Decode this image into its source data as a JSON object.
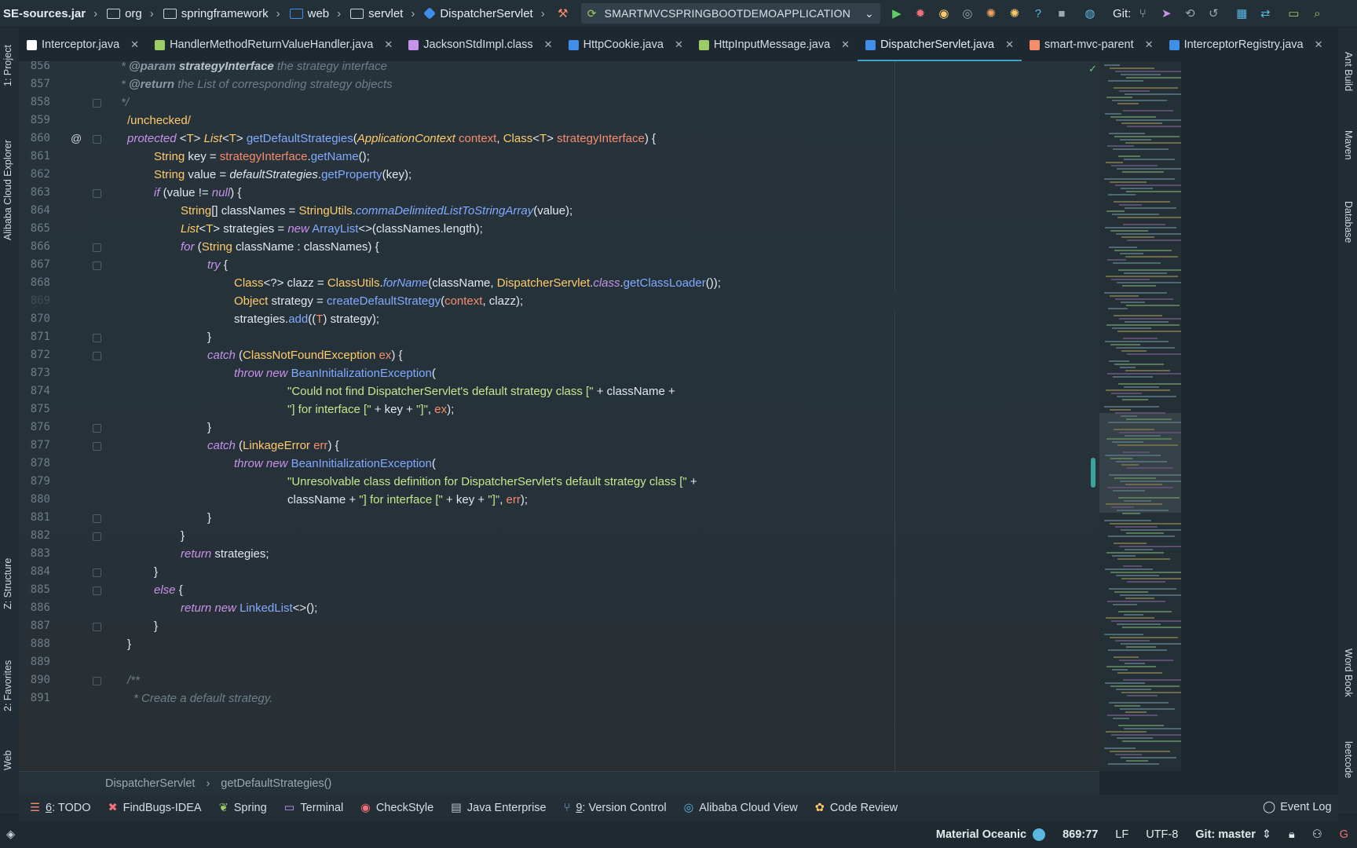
{
  "navbar": {
    "crumbs": [
      "SE-sources.jar",
      "org",
      "springframework",
      "web",
      "servlet",
      "DispatcherServlet"
    ],
    "run_config": "SMARTMVCSPRINGBOOTDEMOAPPLICATION",
    "git_label": "Git:"
  },
  "tabs": [
    {
      "label": "Interceptor.java",
      "icon_color": "#ffffff"
    },
    {
      "label": "HandlerMethodReturnValueHandler.java",
      "icon_color": "#9ccc65"
    },
    {
      "label": "JacksonStdImpl.class",
      "icon_color": "#c792ea"
    },
    {
      "label": "HttpCookie.java",
      "icon_color": "#3f8ee8"
    },
    {
      "label": "HttpInputMessage.java",
      "icon_color": "#9ccc65"
    },
    {
      "label": "DispatcherServlet.java",
      "icon_color": "#3f8ee8",
      "active": true
    },
    {
      "label": "smart-mvc-parent",
      "icon_color": "#f78c6c"
    },
    {
      "label": "InterceptorRegistry.java",
      "icon_color": "#3f8ee8"
    }
  ],
  "tabs_overflow": "3",
  "left_tools": [
    "1: Project",
    "Alibaba Cloud Explorer",
    "Z: Structure",
    "2: Favorites",
    "Web"
  ],
  "right_tools": [
    "Ant Build",
    "Maven",
    "Database",
    "Word Book",
    "leetcode"
  ],
  "editor": {
    "current_line": 869,
    "lines": [
      856,
      857,
      858,
      859,
      860,
      861,
      862,
      863,
      864,
      865,
      866,
      867,
      868,
      869,
      870,
      871,
      872,
      873,
      874,
      875,
      876,
      877,
      878,
      879,
      880,
      881,
      882,
      883,
      884,
      885,
      886,
      887,
      888,
      889,
      890,
      891
    ],
    "code": {
      "l856_tag": "@param",
      "l856_name": "strategyInterface",
      "l856_text": "the strategy interface",
      "l857_tag": "@return",
      "l857_text": "the List of corresponding strategy objects",
      "l859": "/unchecked/",
      "l874_str": "\"Could not find DispatcherServlet's default strategy class [\"",
      "l875_str": "\"] for interface [\"",
      "l875_str2": "\"]\"",
      "l879_str": "\"Unresolvable class definition for DispatcherServlet's default strategy class [\"",
      "l880_str": "\"] for interface [\"",
      "l880_str2": "\"]\"",
      "l891": "* Create a default strategy."
    }
  },
  "edcrumb": [
    "DispatcherServlet",
    "getDefaultStrategies()"
  ],
  "tool_windows": [
    {
      "num": "6",
      "label": ": TODO"
    },
    {
      "num": "",
      "label": "FindBugs-IDEA"
    },
    {
      "num": "",
      "label": "Spring"
    },
    {
      "num": "",
      "label": "Terminal"
    },
    {
      "num": "",
      "label": "CheckStyle"
    },
    {
      "num": "",
      "label": "Java Enterprise"
    },
    {
      "num": "9",
      "label": ": Version Control"
    },
    {
      "num": "",
      "label": "Alibaba Cloud View"
    },
    {
      "num": "",
      "label": "Code Review"
    }
  ],
  "event_log": "Event Log",
  "status": {
    "theme": "Material Oceanic",
    "position": "869:77",
    "line_sep": "LF",
    "encoding": "UTF-8",
    "git_branch": "Git: master"
  },
  "colors": {
    "accent": "#3ba4c7",
    "keyword": "#c792ea",
    "type": "#ffcb6b",
    "function": "#82aaff",
    "string": "#c3e88d"
  }
}
